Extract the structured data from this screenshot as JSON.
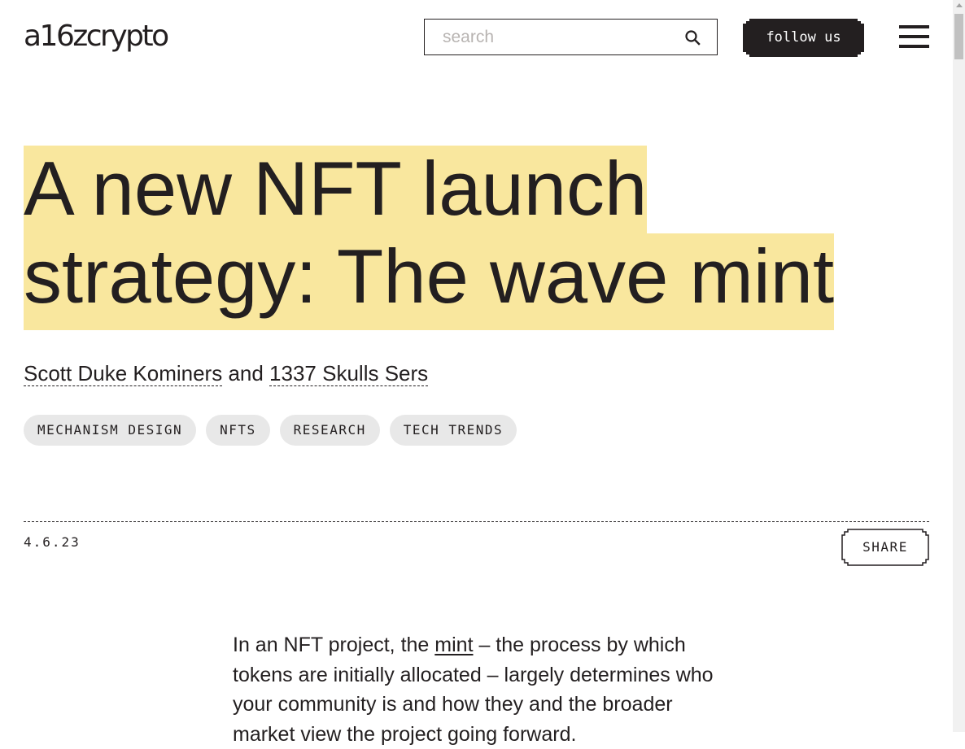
{
  "header": {
    "logo_text": "a16zcrypto",
    "search": {
      "placeholder": "search",
      "value": ""
    },
    "follow_label": "follow us",
    "icons": {
      "search": "search-icon",
      "menu": "hamburger-menu-icon"
    }
  },
  "article": {
    "title_line1": "A new NFT launch",
    "title_line2": "strategy: The wave mint",
    "authors": {
      "author1": "Scott Duke Kominers",
      "joiner": " and ",
      "author2": "1337 Skulls Sers"
    },
    "tags": [
      "MECHANISM DESIGN",
      "NFTS",
      "RESEARCH",
      "TECH TRENDS"
    ],
    "date": "4.6.23",
    "share_label": "SHARE",
    "body": {
      "prefix": "In an NFT project, the ",
      "link": "mint",
      "suffix": " – the process by which tokens are initially allocated – largely determines who your community is and how they and the broader market view the project going forward."
    }
  },
  "colors": {
    "text": "#231f20",
    "highlight": "#f9e79e",
    "tag_bg": "#e8e8e8",
    "background": "#ffffff"
  }
}
